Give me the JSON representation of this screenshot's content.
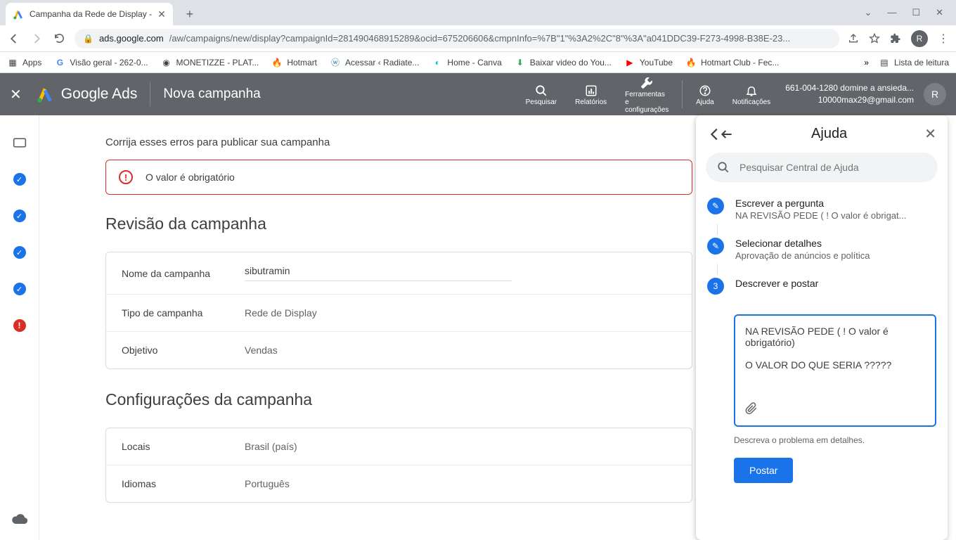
{
  "browser": {
    "tab_title": "Campanha da Rede de Display - ",
    "url_domain": "ads.google.com",
    "url_path": "/aw/campaigns/new/display?campaignId=281490468915289&ocid=675206606&cmpnInfo=%7B\"1\"%3A2%2C\"8\"%3A\"a041DDC39-F273-4998-B38E-23...",
    "avatar_initial": "R",
    "reading_list": "Lista de leitura"
  },
  "bookmarks": {
    "apps": "Apps",
    "items": [
      "Visão geral - 262-0...",
      "MONETIZZE - PLAT...",
      "Hotmart",
      "Acessar ‹ Radiate...",
      "Home - Canva",
      "Baixar video do You...",
      "YouTube",
      "Hotmart Club - Fec..."
    ]
  },
  "gads": {
    "brand": "Google Ads",
    "page": "Nova campanha",
    "icons": {
      "search": "Pesquisar",
      "reports": "Relatórios",
      "tools": "Ferramentas e configurações",
      "help": "Ajuda",
      "notifications": "Notificações"
    },
    "account_line1": "661-004-1280 domine a ansieda...",
    "account_line2": "10000max29@gmail.com",
    "avatar": "R"
  },
  "main": {
    "fix_errors": "Corrija esses erros para publicar sua campanha",
    "error_msg": "O valor é obrigatório",
    "review_head": "Revisão da campanha",
    "rows": {
      "name_label": "Nome da campanha",
      "name_value": "sibutramin",
      "type_label": "Tipo de campanha",
      "type_value": "Rede de Display",
      "obj_label": "Objetivo",
      "obj_value": "Vendas"
    },
    "settings_head": "Configurações da campanha",
    "settings": {
      "loc_label": "Locais",
      "loc_value": "Brasil (país)",
      "lang_label": "Idiomas",
      "lang_value": "Português"
    }
  },
  "help": {
    "title": "Ajuda",
    "search_placeholder": "Pesquisar Central de Ajuda",
    "steps": {
      "s1_title": "Escrever a pergunta",
      "s1_sub": "NA REVISÃO PEDE ( ! O valor é obrigat...",
      "s2_title": "Selecionar detalhes",
      "s2_sub": "Aprovação de anúncios e política",
      "s3_title": "Descrever e postar",
      "s3_num": "3"
    },
    "post_text": "NA REVISÃO PEDE ( ! O valor é obrigatório)\n\nO VALOR DO QUE SERIA ?????",
    "post_hint": "Descreva o problema em detalhes.",
    "post_btn": "Postar"
  }
}
